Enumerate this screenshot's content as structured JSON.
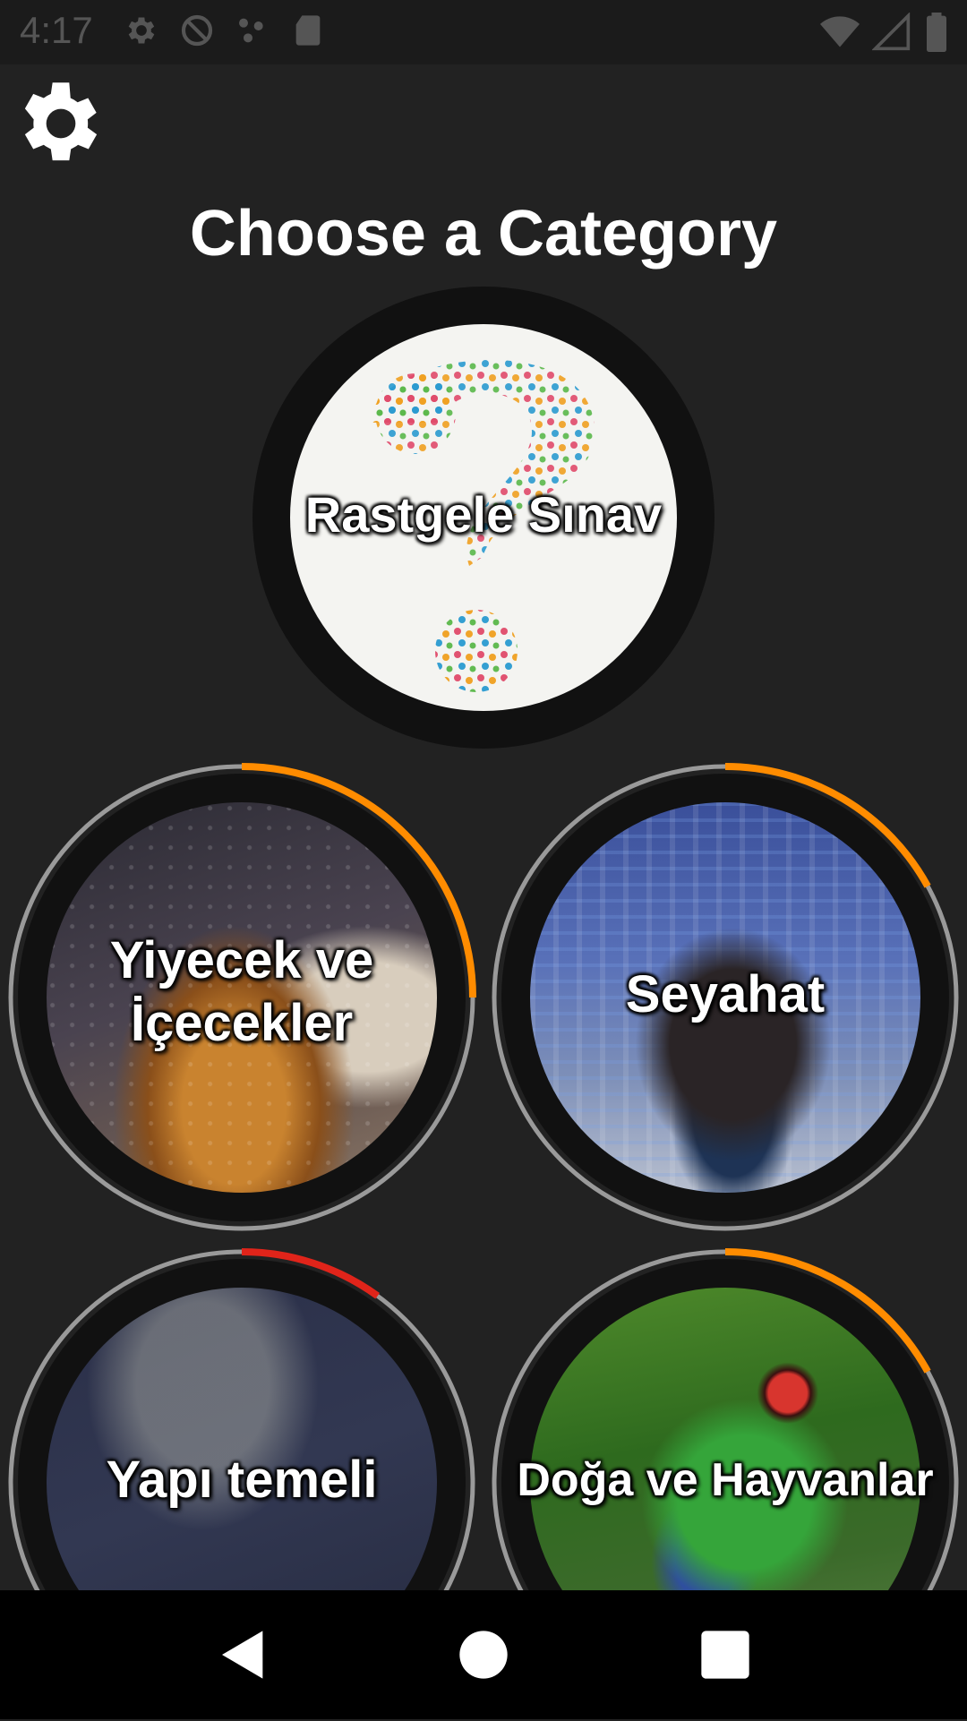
{
  "status_bar": {
    "time": "4:17",
    "left_icons": [
      "gear-icon",
      "no-sync-icon",
      "dots-icon",
      "sd-card-icon"
    ],
    "right_icons": [
      "wifi-icon",
      "signal-icon",
      "battery-icon"
    ]
  },
  "header": {
    "settings_icon": "gear-icon",
    "title": "Choose a Category"
  },
  "categories": {
    "random": {
      "label": "Rastgele Sınav"
    },
    "food": {
      "label_line1": "Yiyecek ve",
      "label_line2": "İçecekler",
      "progress": 0.25
    },
    "travel": {
      "label": "Seyahat",
      "progress": 0.17
    },
    "grammar": {
      "label": "Yapı temeli",
      "progress": 0.1
    },
    "nature": {
      "label": "Doğa ve Hayvanlar",
      "progress": 0.17
    }
  },
  "colors": {
    "background": "#222222",
    "progress_orange": "#ff8c00",
    "progress_red": "#e0241a",
    "ring_track": "#9a9a9a"
  },
  "nav_bar": {
    "icons": [
      "back-icon",
      "home-icon",
      "recents-icon"
    ]
  }
}
